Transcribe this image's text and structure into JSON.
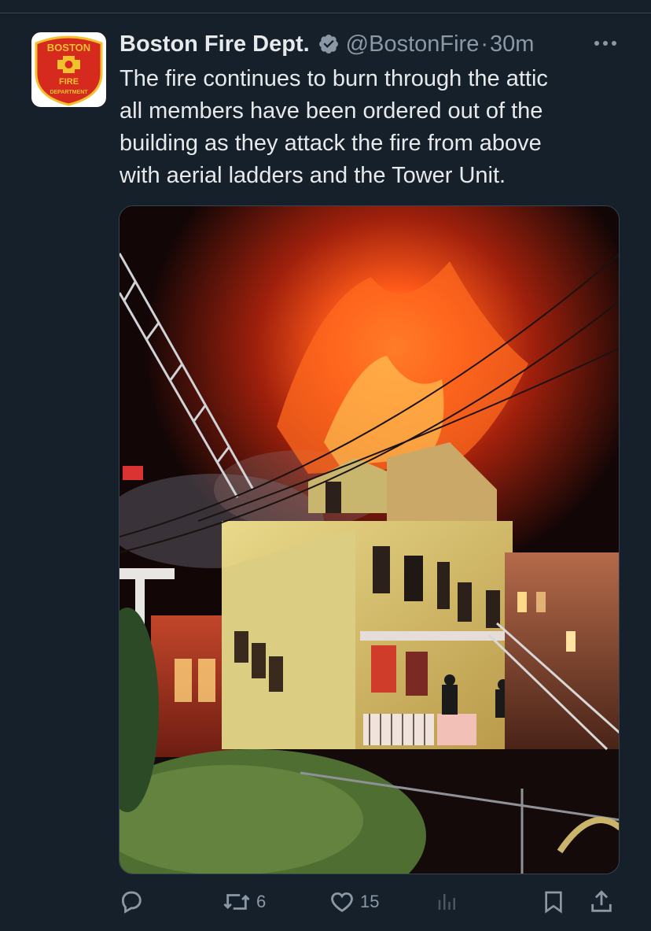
{
  "author": {
    "display_name": "Boston Fire Dept.",
    "handle": "@BostonFire",
    "separator": "·",
    "time": "30m",
    "verified": true,
    "avatar_icon": "boston-fire-department-logo",
    "avatar_logo_text": [
      "BOSTON",
      "FIRE",
      "DEPARTMENT"
    ]
  },
  "tweet": {
    "text_lines": [
      "The fire continues to burn through the attic",
      "all members have been ordered out of the",
      "building as they attack the fire from above",
      "with aerial ladders and the Tower Unit."
    ]
  },
  "media": {
    "type": "photo",
    "icon": "burning-house-photo"
  },
  "actions": {
    "reply": {
      "icon": "reply-icon"
    },
    "retweet": {
      "icon": "retweet-icon",
      "count": "6"
    },
    "like": {
      "icon": "heart-icon",
      "count": "15"
    },
    "views": {
      "icon": "views-icon"
    },
    "bookmark": {
      "icon": "bookmark-icon"
    },
    "share": {
      "icon": "share-icon"
    }
  },
  "colors": {
    "background": "#15202b",
    "text": "#e7e9ea",
    "secondary_text": "#8b98a5",
    "verified": "#8b98a5",
    "divider": "#38444d",
    "logo_red": "#d62a1e",
    "logo_gold": "#f2c12e"
  }
}
